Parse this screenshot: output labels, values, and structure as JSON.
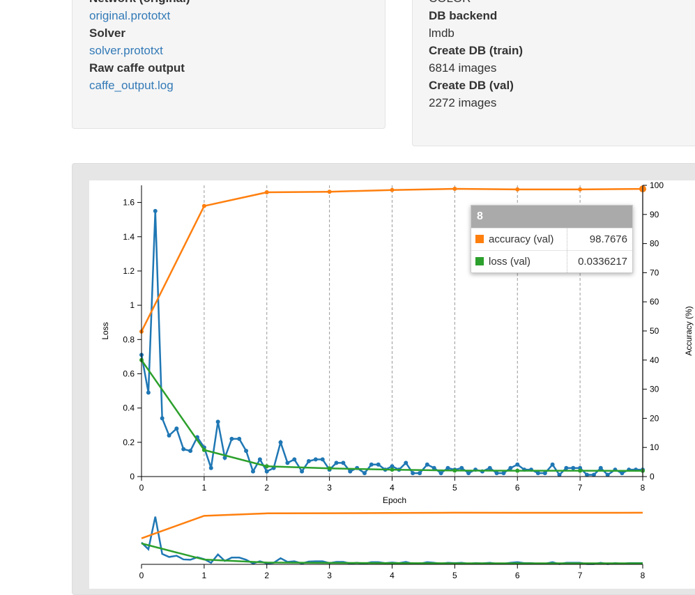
{
  "left_panel": {
    "items": [
      {
        "term": "Network (original)",
        "value": "original.prototxt",
        "link": true
      },
      {
        "term": "Solver",
        "value": "solver.prototxt",
        "link": true
      },
      {
        "term": "Raw caffe output",
        "value": "caffe_output.log",
        "link": true
      }
    ]
  },
  "right_panel": {
    "top_value": "COLOR",
    "items": [
      {
        "term": "DB backend",
        "value": "lmdb"
      },
      {
        "term": "Create DB (train)",
        "value": "6814 images"
      },
      {
        "term": "Create DB (val)",
        "value": "2272 images"
      }
    ]
  },
  "tooltip": {
    "title": "8",
    "rows": [
      {
        "label": "accuracy (val)",
        "value": "98.7676",
        "color": "#ff7f0e"
      },
      {
        "label": "loss (val)",
        "value": "0.0336217",
        "color": "#2ca02c"
      }
    ]
  },
  "chart_data": {
    "type": "line",
    "xlabel": "Epoch",
    "ylabel": "Loss",
    "y2label": "Accuracy (%)",
    "xlim": [
      0,
      8
    ],
    "ylim": [
      0,
      1.7
    ],
    "y2lim": [
      0,
      100
    ],
    "x_ticks": [
      0,
      1,
      2,
      3,
      4,
      5,
      6,
      7,
      8
    ],
    "y_ticks": [
      "0",
      "0.2",
      "0.4",
      "0.6",
      "0.8",
      "1",
      "1.2",
      "1.4",
      "1.6"
    ],
    "y2_ticks": [
      "0",
      "10",
      "20",
      "30",
      "40",
      "50",
      "60",
      "70",
      "80",
      "90",
      "100"
    ],
    "colors": {
      "loss_train": "#1f77b4",
      "accuracy_val": "#ff7f0e",
      "loss_val": "#2ca02c"
    },
    "series": [
      {
        "name": "accuracy (val)",
        "axis": "right",
        "x": [
          0,
          1,
          2,
          3,
          4,
          5,
          6,
          7,
          8
        ],
        "values": [
          49.8,
          92.9,
          97.6,
          97.8,
          98.4,
          98.8,
          98.6,
          98.6,
          98.7676
        ]
      },
      {
        "name": "loss (val)",
        "axis": "left",
        "x": [
          0,
          1,
          2,
          3,
          4,
          5,
          6,
          7,
          8
        ],
        "values": [
          0.68,
          0.155,
          0.06,
          0.048,
          0.04,
          0.035,
          0.034,
          0.034,
          0.0336
        ]
      },
      {
        "name": "loss (train)",
        "axis": "left",
        "x": [
          0,
          0.11,
          0.22,
          0.33,
          0.44,
          0.56,
          0.67,
          0.78,
          0.89,
          1.0,
          1.11,
          1.22,
          1.33,
          1.44,
          1.56,
          1.67,
          1.78,
          1.89,
          2.0,
          2.11,
          2.22,
          2.33,
          2.44,
          2.56,
          2.67,
          2.78,
          2.89,
          3.0,
          3.11,
          3.22,
          3.33,
          3.44,
          3.56,
          3.67,
          3.78,
          3.89,
          4.0,
          4.11,
          4.22,
          4.33,
          4.44,
          4.56,
          4.67,
          4.78,
          4.89,
          5.0,
          5.11,
          5.22,
          5.33,
          5.44,
          5.56,
          5.67,
          5.78,
          5.89,
          6.0,
          6.11,
          6.22,
          6.33,
          6.44,
          6.56,
          6.67,
          6.78,
          6.89,
          7.0,
          7.11,
          7.22,
          7.33,
          7.44,
          7.56,
          7.67,
          7.78,
          7.89,
          8.0
        ],
        "values": [
          0.71,
          0.49,
          1.55,
          0.34,
          0.24,
          0.28,
          0.16,
          0.15,
          0.23,
          0.17,
          0.05,
          0.32,
          0.11,
          0.22,
          0.22,
          0.15,
          0.03,
          0.1,
          0.03,
          0.05,
          0.2,
          0.08,
          0.1,
          0.03,
          0.09,
          0.1,
          0.1,
          0.04,
          0.08,
          0.08,
          0.03,
          0.05,
          0.02,
          0.07,
          0.07,
          0.04,
          0.06,
          0.04,
          0.08,
          0.02,
          0.02,
          0.07,
          0.05,
          0.02,
          0.05,
          0.04,
          0.05,
          0.02,
          0.04,
          0.03,
          0.05,
          0.02,
          0.02,
          0.05,
          0.07,
          0.04,
          0.04,
          0.02,
          0.02,
          0.07,
          0.01,
          0.05,
          0.05,
          0.05,
          0.01,
          0.01,
          0.05,
          0.01,
          0.04,
          0.02,
          0.04,
          0.04,
          0.04
        ]
      }
    ]
  }
}
